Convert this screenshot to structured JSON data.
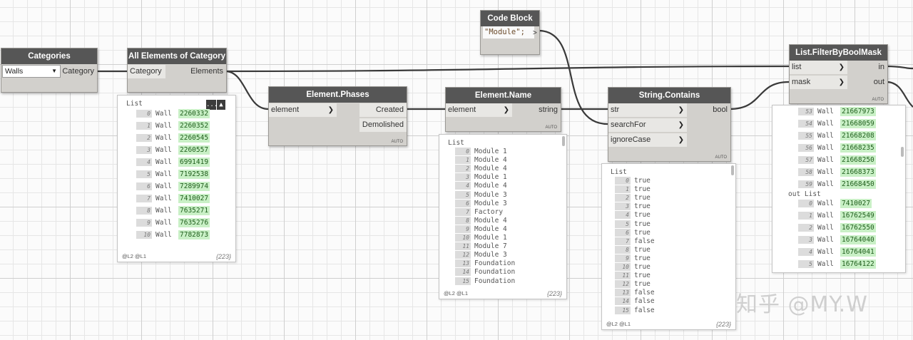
{
  "nodes": {
    "categories": {
      "title": "Categories",
      "dropdown_value": "Walls",
      "out": "Category"
    },
    "all_elements": {
      "title": "All Elements of Category",
      "in": "Category",
      "out": "Elements",
      "menu": "...",
      "pin": "pin"
    },
    "phases": {
      "title": "Element.Phases",
      "in": "element",
      "out1": "Created",
      "out2": "Demolished",
      "auto": "AUTO"
    },
    "code_block": {
      "title": "Code Block",
      "code": "\"Module\";",
      "out": ">"
    },
    "name": {
      "title": "Element.Name",
      "in": "element",
      "out": "string",
      "auto": "AUTO"
    },
    "contains": {
      "title": "String.Contains",
      "in1": "str",
      "in2": "searchFor",
      "in3": "ignoreCase",
      "out": "bool",
      "auto": "AUTO"
    },
    "filter": {
      "title": "List.FilterByBoolMask",
      "in1": "list",
      "in2": "mask",
      "out1": "in",
      "out2": "out",
      "auto": "AUTO"
    }
  },
  "previews": {
    "elements": {
      "head": "List",
      "footer": "@L2 @L1",
      "count": "{223}",
      "items": [
        {
          "i": "0",
          "l": "Wall",
          "v": "2260332"
        },
        {
          "i": "1",
          "l": "Wall",
          "v": "2260352"
        },
        {
          "i": "2",
          "l": "Wall",
          "v": "2260545"
        },
        {
          "i": "3",
          "l": "Wall",
          "v": "2260557"
        },
        {
          "i": "4",
          "l": "Wall",
          "v": "6991419"
        },
        {
          "i": "5",
          "l": "Wall",
          "v": "7192538"
        },
        {
          "i": "6",
          "l": "Wall",
          "v": "7289974"
        },
        {
          "i": "7",
          "l": "Wall",
          "v": "7410027"
        },
        {
          "i": "8",
          "l": "Wall",
          "v": "7635271"
        },
        {
          "i": "9",
          "l": "Wall",
          "v": "7635276"
        },
        {
          "i": "10",
          "l": "Wall",
          "v": "7782873"
        }
      ]
    },
    "names": {
      "head": "List",
      "footer": "@L2 @L1",
      "count": "{223}",
      "items": [
        {
          "i": "0",
          "t": "Module 1"
        },
        {
          "i": "1",
          "t": "Module 4"
        },
        {
          "i": "2",
          "t": "Module 4"
        },
        {
          "i": "3",
          "t": "Module 1"
        },
        {
          "i": "4",
          "t": "Module 4"
        },
        {
          "i": "5",
          "t": "Module 3"
        },
        {
          "i": "6",
          "t": "Module 3"
        },
        {
          "i": "7",
          "t": "Factory"
        },
        {
          "i": "8",
          "t": "Module 4"
        },
        {
          "i": "9",
          "t": "Module 4"
        },
        {
          "i": "10",
          "t": "Module 1"
        },
        {
          "i": "11",
          "t": "Module 7"
        },
        {
          "i": "12",
          "t": "Module 3"
        },
        {
          "i": "13",
          "t": "Foundation"
        },
        {
          "i": "14",
          "t": "Foundation"
        },
        {
          "i": "15",
          "t": "Foundation"
        }
      ]
    },
    "bools": {
      "head": "List",
      "footer": "@L2 @L1",
      "count": "{223}",
      "items": [
        {
          "i": "0",
          "t": "true"
        },
        {
          "i": "1",
          "t": "true"
        },
        {
          "i": "2",
          "t": "true"
        },
        {
          "i": "3",
          "t": "true"
        },
        {
          "i": "4",
          "t": "true"
        },
        {
          "i": "5",
          "t": "true"
        },
        {
          "i": "6",
          "t": "true"
        },
        {
          "i": "7",
          "t": "false"
        },
        {
          "i": "8",
          "t": "true"
        },
        {
          "i": "9",
          "t": "true"
        },
        {
          "i": "10",
          "t": "true"
        },
        {
          "i": "11",
          "t": "true"
        },
        {
          "i": "12",
          "t": "true"
        },
        {
          "i": "13",
          "t": "false"
        },
        {
          "i": "14",
          "t": "false"
        },
        {
          "i": "15",
          "t": "false"
        }
      ]
    },
    "filter": {
      "in_items": [
        {
          "i": "53",
          "l": "Wall",
          "v": "21667973"
        },
        {
          "i": "54",
          "l": "Wall",
          "v": "21668059"
        },
        {
          "i": "55",
          "l": "Wall",
          "v": "21668208"
        },
        {
          "i": "56",
          "l": "Wall",
          "v": "21668235"
        },
        {
          "i": "57",
          "l": "Wall",
          "v": "21668250"
        },
        {
          "i": "58",
          "l": "Wall",
          "v": "21668373"
        },
        {
          "i": "59",
          "l": "Wall",
          "v": "21668450"
        }
      ],
      "out_head": "out List",
      "out_items": [
        {
          "i": "0",
          "l": "Wall",
          "v": "7410027"
        },
        {
          "i": "1",
          "l": "Wall",
          "v": "16762549"
        },
        {
          "i": "2",
          "l": "Wall",
          "v": "16762550"
        },
        {
          "i": "3",
          "l": "Wall",
          "v": "16764040"
        },
        {
          "i": "4",
          "l": "Wall",
          "v": "16764041"
        },
        {
          "i": "5",
          "l": "Wall",
          "v": "16764122"
        }
      ]
    }
  },
  "watermark": "知乎 @MY.W"
}
